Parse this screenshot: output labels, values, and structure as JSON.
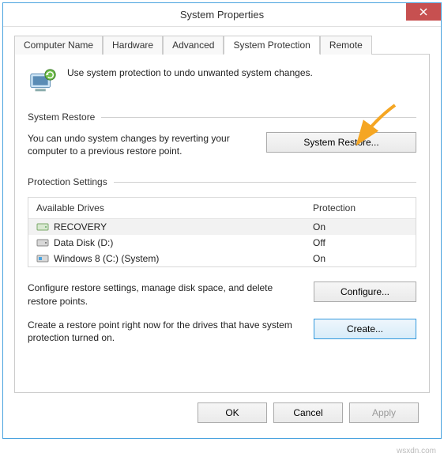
{
  "window": {
    "title": "System Properties"
  },
  "tabs": {
    "items": [
      {
        "label": "Computer Name"
      },
      {
        "label": "Hardware"
      },
      {
        "label": "Advanced"
      },
      {
        "label": "System Protection"
      },
      {
        "label": "Remote"
      }
    ],
    "active_index": 3
  },
  "intro": {
    "text": "Use system protection to undo unwanted system changes."
  },
  "restore": {
    "section_label": "System Restore",
    "text": "You can undo system changes by reverting your computer to a previous restore point.",
    "button": "System Restore..."
  },
  "protection": {
    "section_label": "Protection Settings",
    "col_drive": "Available Drives",
    "col_prot": "Protection",
    "drives": [
      {
        "name": "RECOVERY",
        "protection": "On",
        "icon": "drive-hd",
        "selected": true
      },
      {
        "name": "Data Disk (D:)",
        "protection": "Off",
        "icon": "drive-hd",
        "selected": false
      },
      {
        "name": "Windows 8 (C:) (System)",
        "protection": "On",
        "icon": "drive-win",
        "selected": false
      }
    ]
  },
  "configure": {
    "text": "Configure restore settings, manage disk space, and delete restore points.",
    "button": "Configure..."
  },
  "create": {
    "text": "Create a restore point right now for the drives that have system protection turned on.",
    "button": "Create..."
  },
  "footer": {
    "ok": "OK",
    "cancel": "Cancel",
    "apply": "Apply"
  },
  "watermark": "wsxdn.com"
}
